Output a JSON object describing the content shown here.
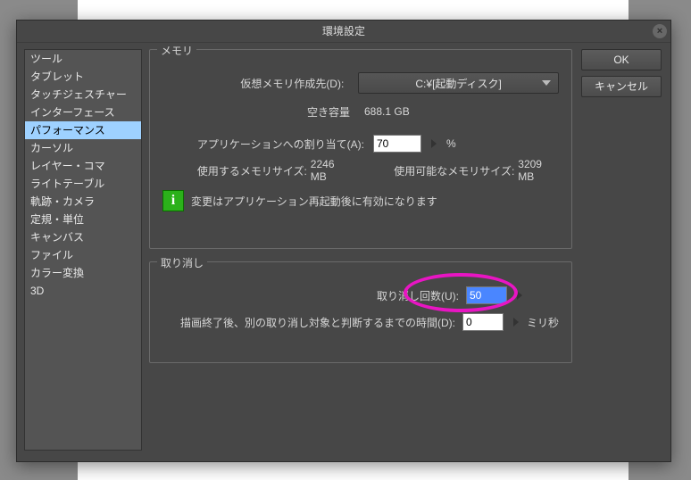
{
  "dialog": {
    "title": "環境設定"
  },
  "buttons": {
    "ok": "OK",
    "cancel": "キャンセル"
  },
  "sidebar": {
    "items": [
      "ツール",
      "タブレット",
      "タッチジェスチャー",
      "インターフェース",
      "パフォーマンス",
      "カーソル",
      "レイヤー・コマ",
      "ライトテーブル",
      "軌跡・カメラ",
      "定規・単位",
      "キャンバス",
      "ファイル",
      "カラー変換",
      "3D"
    ],
    "selected_index": 4
  },
  "memory": {
    "title": "メモリ",
    "vm_label": "仮想メモリ作成先(D):",
    "vm_value": "C:¥[起動ディスク]",
    "free_label": "空き容量",
    "free_value": "688.1 GB",
    "alloc_label": "アプリケーションへの割り当て(A):",
    "alloc_value": "70",
    "alloc_unit": "%",
    "used_label": "使用するメモリサイズ:",
    "used_value": "2246 MB",
    "avail_label": "使用可能なメモリサイズ:",
    "avail_value": "3209 MB",
    "restart_note": "変更はアプリケーション再起動後に有効になります"
  },
  "undo": {
    "title": "取り消し",
    "count_label": "取り消し回数(U):",
    "count_value": "50",
    "delay_label": "描画終了後、別の取り消し対象と判断するまでの時間(D):",
    "delay_value": "0",
    "delay_unit": "ミリ秒"
  }
}
